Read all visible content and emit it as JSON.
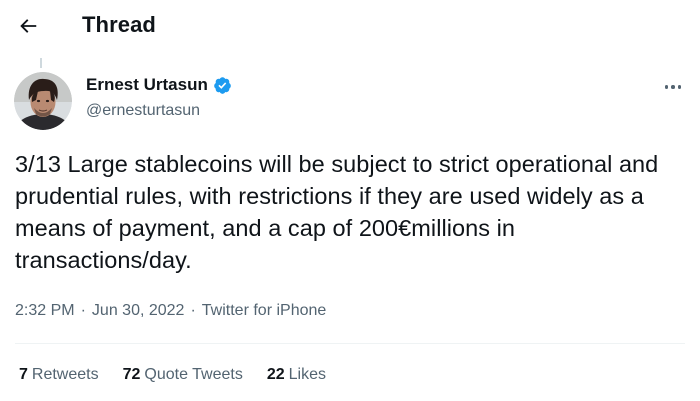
{
  "header": {
    "title": "Thread",
    "back_icon": "arrow-left-icon"
  },
  "tweet": {
    "author": {
      "display_name": "Ernest Urtasun",
      "handle": "@ernesturtasun",
      "verified": true,
      "verified_color": "#1d9bf0"
    },
    "text": "3/13 Large stablecoins will be subject to strict operational and prudential rules, with restrictions if they are used widely as a means of payment, and a cap of 200€millions in transactions/day.",
    "time": "2:32 PM",
    "separator1": "·",
    "date": "Jun 30, 2022",
    "separator2": "·",
    "source": "Twitter for iPhone",
    "more_icon": "more-horizontal-icon"
  },
  "stats": {
    "retweets_count": "7",
    "retweets_label": "Retweets",
    "quotes_count": "72",
    "quotes_label": "Quote Tweets",
    "likes_count": "22",
    "likes_label": "Likes"
  },
  "colors": {
    "text_primary": "#0f1419",
    "text_secondary": "#536471",
    "divider": "#eff3f4",
    "accent": "#1d9bf0"
  }
}
